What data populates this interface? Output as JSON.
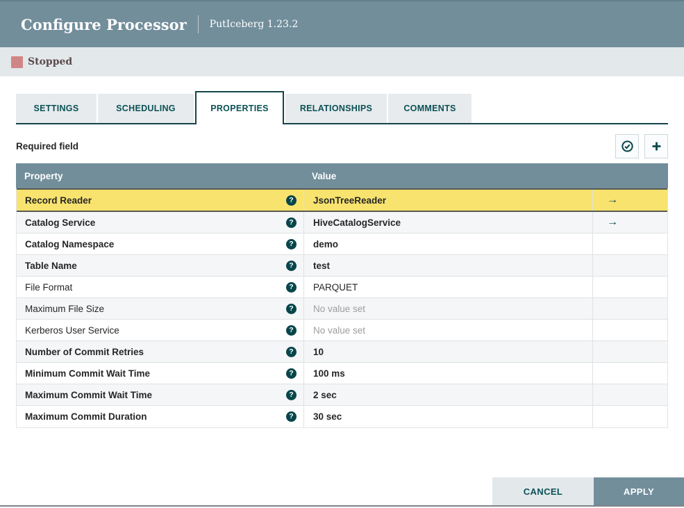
{
  "dialog": {
    "title": "Configure Processor",
    "subtitle": "PutIceberg 1.23.2"
  },
  "status": {
    "label": "Stopped"
  },
  "tabs": [
    {
      "label": "SETTINGS",
      "active": false
    },
    {
      "label": "SCHEDULING",
      "active": false
    },
    {
      "label": "PROPERTIES",
      "active": true
    },
    {
      "label": "RELATIONSHIPS",
      "active": false
    },
    {
      "label": "COMMENTS",
      "active": false
    }
  ],
  "properties_panel": {
    "required_label": "Required field",
    "toolbar": {
      "verify_icon": "check-circle-icon",
      "add_icon": "plus-icon"
    },
    "table": {
      "columns": [
        "Property",
        "Value"
      ],
      "rows": [
        {
          "property": "Record Reader",
          "value": "JsonTreeReader",
          "required": true,
          "unset": false,
          "goto": true,
          "highlighted": true
        },
        {
          "property": "Catalog Service",
          "value": "HiveCatalogService",
          "required": true,
          "unset": false,
          "goto": true,
          "highlighted": false
        },
        {
          "property": "Catalog Namespace",
          "value": "demo",
          "required": true,
          "unset": false,
          "goto": false,
          "highlighted": false
        },
        {
          "property": "Table Name",
          "value": "test",
          "required": true,
          "unset": false,
          "goto": false,
          "highlighted": false
        },
        {
          "property": "File Format",
          "value": "PARQUET",
          "required": false,
          "unset": false,
          "goto": false,
          "highlighted": false
        },
        {
          "property": "Maximum File Size",
          "value": "No value set",
          "required": false,
          "unset": true,
          "goto": false,
          "highlighted": false
        },
        {
          "property": "Kerberos User Service",
          "value": "No value set",
          "required": false,
          "unset": true,
          "goto": false,
          "highlighted": false
        },
        {
          "property": "Number of Commit Retries",
          "value": "10",
          "required": true,
          "unset": false,
          "goto": false,
          "highlighted": false
        },
        {
          "property": "Minimum Commit Wait Time",
          "value": "100 ms",
          "required": true,
          "unset": false,
          "goto": false,
          "highlighted": false
        },
        {
          "property": "Maximum Commit Wait Time",
          "value": "2 sec",
          "required": true,
          "unset": false,
          "goto": false,
          "highlighted": false
        },
        {
          "property": "Maximum Commit Duration",
          "value": "30 sec",
          "required": true,
          "unset": false,
          "goto": false,
          "highlighted": false
        }
      ]
    }
  },
  "icons": {
    "help_glyph": "?",
    "goto_glyph": "→"
  },
  "footer": {
    "cancel_label": "CANCEL",
    "apply_label": "APPLY"
  },
  "colors": {
    "header": "#728e9b",
    "status_bar": "#e3e8eb",
    "stopped_icon": "#d18686",
    "stopped_text": "#5c4a4c",
    "accent_teal": "#0a484d",
    "tab_border": "#14444a",
    "highlight_row": "#f8e36e",
    "alt_row": "#f4f6f7"
  }
}
